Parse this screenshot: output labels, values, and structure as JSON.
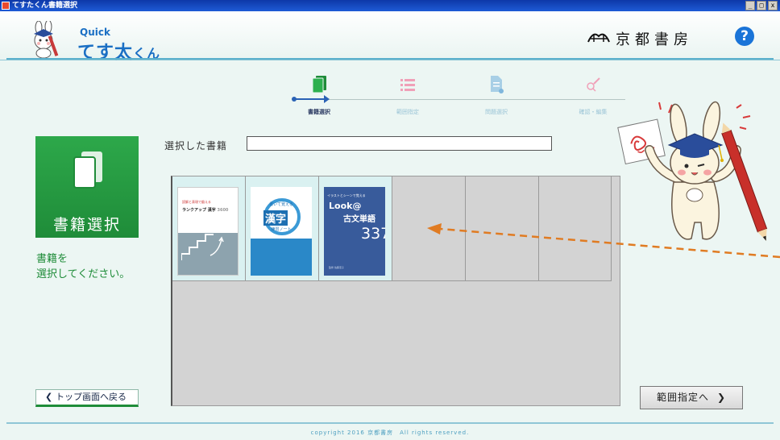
{
  "window": {
    "title": "てすたくん書籍選択",
    "controls": [
      "_",
      "□",
      "x"
    ]
  },
  "header": {
    "logo_quick": "Quick",
    "logo_main": "てす太",
    "logo_suffix": "くん",
    "publisher": "京都書房",
    "help": "?"
  },
  "steps": [
    {
      "label": "書籍選択",
      "icon": "books-icon",
      "active": true
    },
    {
      "label": "範囲指定",
      "icon": "list-icon",
      "active": false
    },
    {
      "label": "問題選択",
      "icon": "document-add-icon",
      "active": false
    },
    {
      "label": "確認・編集",
      "icon": "search-edit-icon",
      "active": false
    }
  ],
  "left_panel": {
    "section_title": "書籍選択",
    "instruction_line1": "書籍を",
    "instruction_line2": "選択してください。"
  },
  "selection": {
    "label": "選択した書籍",
    "value": ""
  },
  "books": [
    {
      "line1": "読解と表現で鍛える",
      "line2": "ランクアップ 漢字",
      "line3": "3600"
    },
    {
      "line1": "書いて覚える",
      "line2": "漢字",
      "line3": "練習ノート"
    },
    {
      "line1": "イラストとシーンで覚える",
      "line2": "Look@",
      "line3": "古文単語",
      "line4": "337",
      "line5": "監修 佐藤恵子"
    }
  ],
  "buttons": {
    "back": "トップ画面へ戻る",
    "next": "範囲指定へ"
  },
  "footer": {
    "copyright": "copyright 2016 京都書房　All rights reserved."
  },
  "colors": {
    "accent_green": "#1f8c39",
    "accent_blue": "#1a6fc4",
    "arrow_orange": "#e07b22"
  }
}
